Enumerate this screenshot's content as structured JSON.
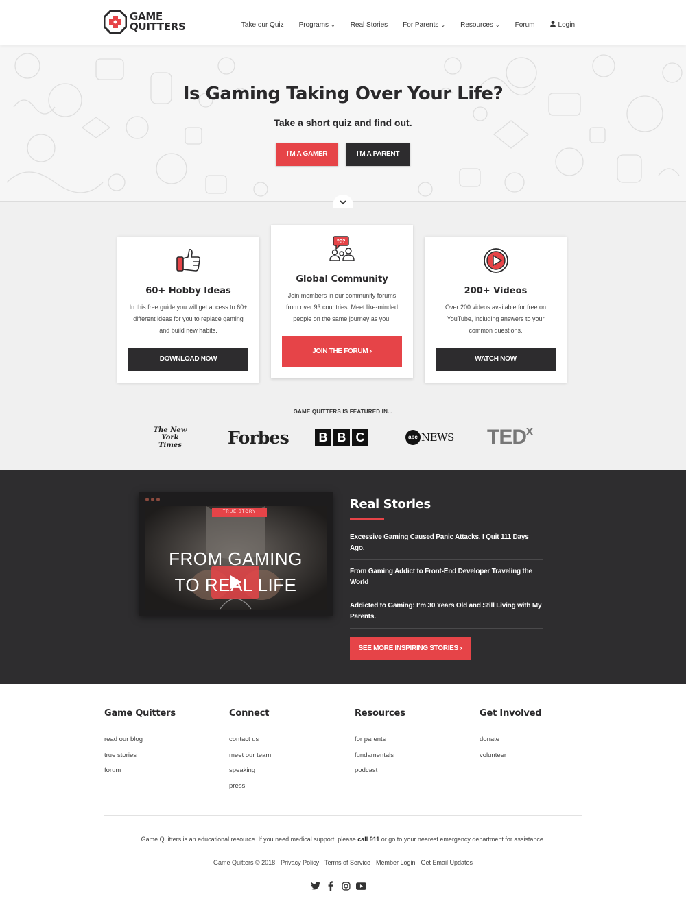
{
  "brand": {
    "logo_line1": "GAME",
    "logo_line2": "QUITTERS",
    "accent": "#e64448",
    "dark": "#2d2c2e"
  },
  "nav": {
    "items": [
      {
        "label": "Take our Quiz",
        "dropdown": false
      },
      {
        "label": "Programs",
        "dropdown": true
      },
      {
        "label": "Real Stories",
        "dropdown": false
      },
      {
        "label": "For Parents",
        "dropdown": true
      },
      {
        "label": "Resources",
        "dropdown": true
      },
      {
        "label": "Forum",
        "dropdown": false
      }
    ],
    "login_label": "Login",
    "chevron": "⌄"
  },
  "hero": {
    "title": "Is Gaming Taking Over Your Life?",
    "subtitle": "Take a short quiz and find out.",
    "gamer_button": "I'M A GAMER",
    "parent_button": "I'M A PARENT"
  },
  "features": {
    "cards": [
      {
        "icon": "thumbs-up-icon",
        "title": "60+ Hobby Ideas",
        "description": "In this free guide you will get access to 60+ different ideas for you to replace gaming and build new habits.",
        "button": "DOWNLOAD NOW"
      },
      {
        "icon": "community-icon",
        "icon_bubble_text": "???",
        "title": "Global Community",
        "description": "Join members in our community forums from over 93 countries. Meet like-minded people on the same journey as you.",
        "button": "JOIN THE FORUM  ›"
      },
      {
        "icon": "play-circle-icon",
        "title": "200+ Videos",
        "description": "Over 200 videos available for free on YouTube, including answers to your common questions.",
        "button": "WATCH NOW"
      }
    ],
    "featured_label": "GAME QUITTERS IS FEATURED IN...",
    "press": [
      {
        "name": "The New York Times",
        "line1": "The New York",
        "line2": "Times"
      },
      {
        "name": "Forbes"
      },
      {
        "name": "BBC",
        "letters": [
          "B",
          "B",
          "C"
        ]
      },
      {
        "name": "abc NEWS",
        "mark": "abc",
        "word": "NEWS"
      },
      {
        "name": "TEDx",
        "word": "TED",
        "suffix": "x"
      }
    ]
  },
  "stories": {
    "video_badge": "TRUE STORY",
    "video_line1": "FROM GAMING",
    "video_line2": "TO REAL LIFE",
    "title": "Real Stories",
    "items": [
      "Excessive Gaming Caused Panic Attacks. I Quit 111 Days Ago.",
      "From Gaming Addict to Front-End Developer Traveling the World",
      "Addicted to Gaming: I’m 30 Years Old and Still Living with My Parents."
    ],
    "button": "SEE MORE INSPIRING STORIES  ›"
  },
  "footer": {
    "columns": [
      {
        "title": "Game Quitters",
        "links": [
          "read our blog",
          "true stories",
          "forum"
        ]
      },
      {
        "title": "Connect",
        "links": [
          "contact us",
          "meet our team",
          "speaking",
          "press"
        ]
      },
      {
        "title": "Resources",
        "links": [
          "for parents",
          "fundamentals",
          "podcast"
        ]
      },
      {
        "title": "Get Involved",
        "links": [
          "donate",
          "volunteer"
        ]
      }
    ],
    "disclaimer_before": "Game Quitters is an educational resource. If you need medical support, please ",
    "disclaimer_bold": "call 911",
    "disclaimer_after": " or go to your nearest emergency department for assistance.",
    "legal": "Game Quitters © 2018 · Privacy Policy · Terms of Service · Member Login · Get Email Updates",
    "socials": [
      "twitter-icon",
      "facebook-icon",
      "instagram-icon",
      "youtube-icon"
    ]
  }
}
